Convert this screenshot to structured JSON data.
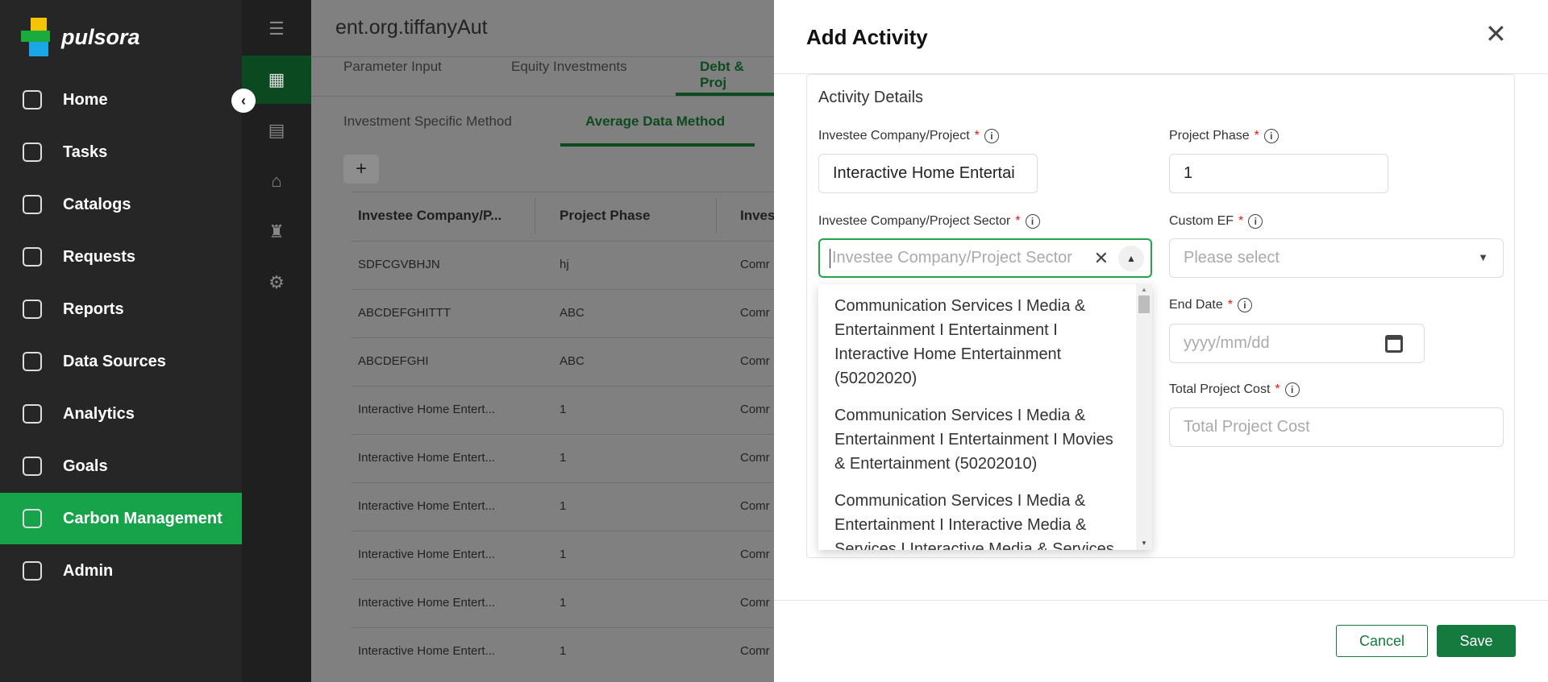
{
  "brand": {
    "name": "pulsora"
  },
  "sidebar": {
    "items": [
      {
        "label": "Home",
        "icon": "home-icon"
      },
      {
        "label": "Tasks",
        "icon": "inbox-icon"
      },
      {
        "label": "Catalogs",
        "icon": "document-icon"
      },
      {
        "label": "Requests",
        "icon": "requests-icon"
      },
      {
        "label": "Reports",
        "icon": "reports-icon"
      },
      {
        "label": "Data Sources",
        "icon": "database-icon"
      },
      {
        "label": "Analytics",
        "icon": "chart-icon"
      },
      {
        "label": "Goals",
        "icon": "target-icon"
      },
      {
        "label": "Carbon Management",
        "icon": "cloud-co2-icon",
        "active": true
      },
      {
        "label": "Admin",
        "icon": "user-check-icon"
      }
    ]
  },
  "main": {
    "title": "ent.org.tiffanyAut",
    "tabs": [
      "Parameter Input",
      "Equity Investments",
      "Debt & Proj"
    ],
    "subtabs": [
      "Investment Specific Method",
      "Average Data Method"
    ],
    "add_label": "+",
    "columns": [
      "Investee Company/P...",
      "Project Phase",
      "Inves"
    ],
    "rows": [
      [
        "SDFCGVBHJN",
        "hj",
        "Comr"
      ],
      [
        "ABCDEFGHITTT",
        "ABC",
        "Comr"
      ],
      [
        "ABCDEFGHI",
        "ABC",
        "Comr"
      ],
      [
        "Interactive Home Entert...",
        "1",
        "Comr"
      ],
      [
        "Interactive Home Entert...",
        "1",
        "Comr"
      ],
      [
        "Interactive Home Entert...",
        "1",
        "Comr"
      ],
      [
        "Interactive Home Entert...",
        "1",
        "Comr"
      ],
      [
        "Interactive Home Entert...",
        "1",
        "Comr"
      ],
      [
        "Interactive Home Entert...",
        "1",
        "Comr"
      ]
    ]
  },
  "modal": {
    "title": "Add Activity",
    "section": "Activity Details",
    "fields": {
      "company": {
        "label": "Investee Company/Project",
        "value": "Interactive Home Entertai"
      },
      "phase": {
        "label": "Project Phase",
        "value": "1"
      },
      "sector": {
        "label": "Investee Company/Project Sector",
        "placeholder": "Investee Company/Project Sector"
      },
      "custom_ef": {
        "label": "Custom EF",
        "placeholder": "Please select"
      },
      "end_date": {
        "label": "End Date",
        "placeholder": "yyyy/mm/dd"
      },
      "total_cost": {
        "label": "Total Project Cost",
        "placeholder": "Total Project Cost"
      }
    },
    "options": [
      "Communication Services I Media & Entertainment I Entertainment I Interactive Home Entertainment (50202020)",
      "Communication Services I Media & Entertainment I Entertainment I Movies & Entertainment (50202010)",
      "Communication Services I Media & Entertainment I Interactive Media & Services I Interactive Media & Services"
    ],
    "cancel": "Cancel",
    "save": "Save",
    "accent": "#157a3e"
  }
}
